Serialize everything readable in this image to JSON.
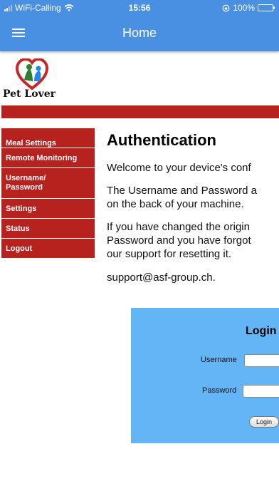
{
  "status_bar": {
    "carrier": "WiFi-Calling",
    "time": "15:56",
    "battery": "100%",
    "battery_level": 1.0
  },
  "app_bar": {
    "title": "Home",
    "menu_icon": "hamburger-menu-icon"
  },
  "logo": {
    "text": "Pet Lover",
    "icon": "heart-pets-logo"
  },
  "nav": {
    "items": [
      {
        "label": "Meal Settings"
      },
      {
        "label": "Remote Monitoring"
      },
      {
        "label": "Username/",
        "label2": "Password"
      },
      {
        "label": "Settings"
      },
      {
        "label": "Status"
      },
      {
        "label": "Logout"
      }
    ]
  },
  "main": {
    "heading": "Authentication",
    "p1": "Welcome to your device's conf",
    "p2_line1": "The Username and Password a",
    "p2_line2": "on the back of your machine.",
    "p3_line1": "If you have changed the origin",
    "p3_line2": "Password and you have forgot",
    "p3_line3": "our support for resetting it.",
    "email": "support@asf-group.ch."
  },
  "login": {
    "title": "Login",
    "username_label": "Username",
    "password_label": "Password",
    "username_value": "",
    "password_value": "",
    "button_label": "Login"
  },
  "colors": {
    "app_bar": "#4a90e2",
    "brand_red": "#b7221f",
    "login_panel": "#64b5f6"
  }
}
